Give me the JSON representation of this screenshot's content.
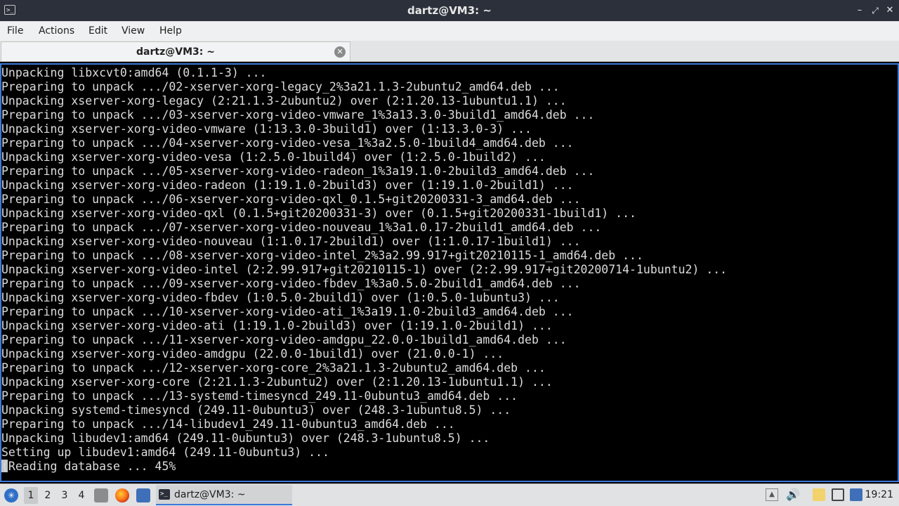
{
  "window": {
    "title": "dartz@VM3: ~",
    "app_icon": "terminal-icon",
    "controls": [
      "minimize-icon",
      "maximize-icon",
      "close-icon"
    ]
  },
  "menu": [
    "File",
    "Actions",
    "Edit",
    "View",
    "Help"
  ],
  "tab": {
    "label": "dartz@VM3: ~",
    "close_icon": "tab-close-icon"
  },
  "terminal": {
    "lines": [
      "Unpacking libxcvt0:amd64 (0.1.1-3) ...",
      "Preparing to unpack .../02-xserver-xorg-legacy_2%3a21.1.3-2ubuntu2_amd64.deb ...",
      "Unpacking xserver-xorg-legacy (2:21.1.3-2ubuntu2) over (2:1.20.13-1ubuntu1.1) ...",
      "Preparing to unpack .../03-xserver-xorg-video-vmware_1%3a13.3.0-3build1_amd64.deb ...",
      "Unpacking xserver-xorg-video-vmware (1:13.3.0-3build1) over (1:13.3.0-3) ...",
      "Preparing to unpack .../04-xserver-xorg-video-vesa_1%3a2.5.0-1build4_amd64.deb ...",
      "Unpacking xserver-xorg-video-vesa (1:2.5.0-1build4) over (1:2.5.0-1build2) ...",
      "Preparing to unpack .../05-xserver-xorg-video-radeon_1%3a19.1.0-2build3_amd64.deb ...",
      "Unpacking xserver-xorg-video-radeon (1:19.1.0-2build3) over (1:19.1.0-2build1) ...",
      "Preparing to unpack .../06-xserver-xorg-video-qxl_0.1.5+git20200331-3_amd64.deb ...",
      "Unpacking xserver-xorg-video-qxl (0.1.5+git20200331-3) over (0.1.5+git20200331-1build1) ...",
      "Preparing to unpack .../07-xserver-xorg-video-nouveau_1%3a1.0.17-2build1_amd64.deb ...",
      "Unpacking xserver-xorg-video-nouveau (1:1.0.17-2build1) over (1:1.0.17-1build1) ...",
      "Preparing to unpack .../08-xserver-xorg-video-intel_2%3a2.99.917+git20210115-1_amd64.deb ...",
      "Unpacking xserver-xorg-video-intel (2:2.99.917+git20210115-1) over (2:2.99.917+git20200714-1ubuntu2) ...",
      "Preparing to unpack .../09-xserver-xorg-video-fbdev_1%3a0.5.0-2build1_amd64.deb ...",
      "Unpacking xserver-xorg-video-fbdev (1:0.5.0-2build1) over (1:0.5.0-1ubuntu3) ...",
      "Preparing to unpack .../10-xserver-xorg-video-ati_1%3a19.1.0-2build3_amd64.deb ...",
      "Unpacking xserver-xorg-video-ati (1:19.1.0-2build3) over (1:19.1.0-2build1) ...",
      "Preparing to unpack .../11-xserver-xorg-video-amdgpu_22.0.0-1build1_amd64.deb ...",
      "Unpacking xserver-xorg-video-amdgpu (22.0.0-1build1) over (21.0.0-1) ...",
      "Preparing to unpack .../12-xserver-xorg-core_2%3a21.1.3-2ubuntu2_amd64.deb ...",
      "Unpacking xserver-xorg-core (2:21.1.3-2ubuntu2) over (2:1.20.13-1ubuntu1.1) ...",
      "Preparing to unpack .../13-systemd-timesyncd_249.11-0ubuntu3_amd64.deb ...",
      "Unpacking systemd-timesyncd (249.11-0ubuntu3) over (248.3-1ubuntu8.5) ...",
      "Preparing to unpack .../14-libudev1_249.11-0ubuntu3_amd64.deb ...",
      "Unpacking libudev1:amd64 (249.11-0ubuntu3) over (248.3-1ubuntu8.5) ...",
      "Setting up libudev1:amd64 (249.11-0ubuntu3) ...",
      "(Reading database ... 45%"
    ]
  },
  "taskbar": {
    "start_icon": "start-menu-icon",
    "workspaces": [
      "1",
      "2",
      "3",
      "4"
    ],
    "active_workspace": "1",
    "quick_launch": [
      "file-manager-icon",
      "firefox-icon",
      "show-desktop-icon"
    ],
    "task_label": "dartz@VM3: ~",
    "tray": [
      "tray-expand-icon",
      "volume-icon",
      "clipboard-icon",
      "screen-icon",
      "network-icon"
    ],
    "clock": "19:21"
  },
  "colors": {
    "titlebar": "#2b303a",
    "terminal_bg": "#000000",
    "terminal_fg": "#dcdcdc",
    "focus_border": "#3c78d8"
  }
}
